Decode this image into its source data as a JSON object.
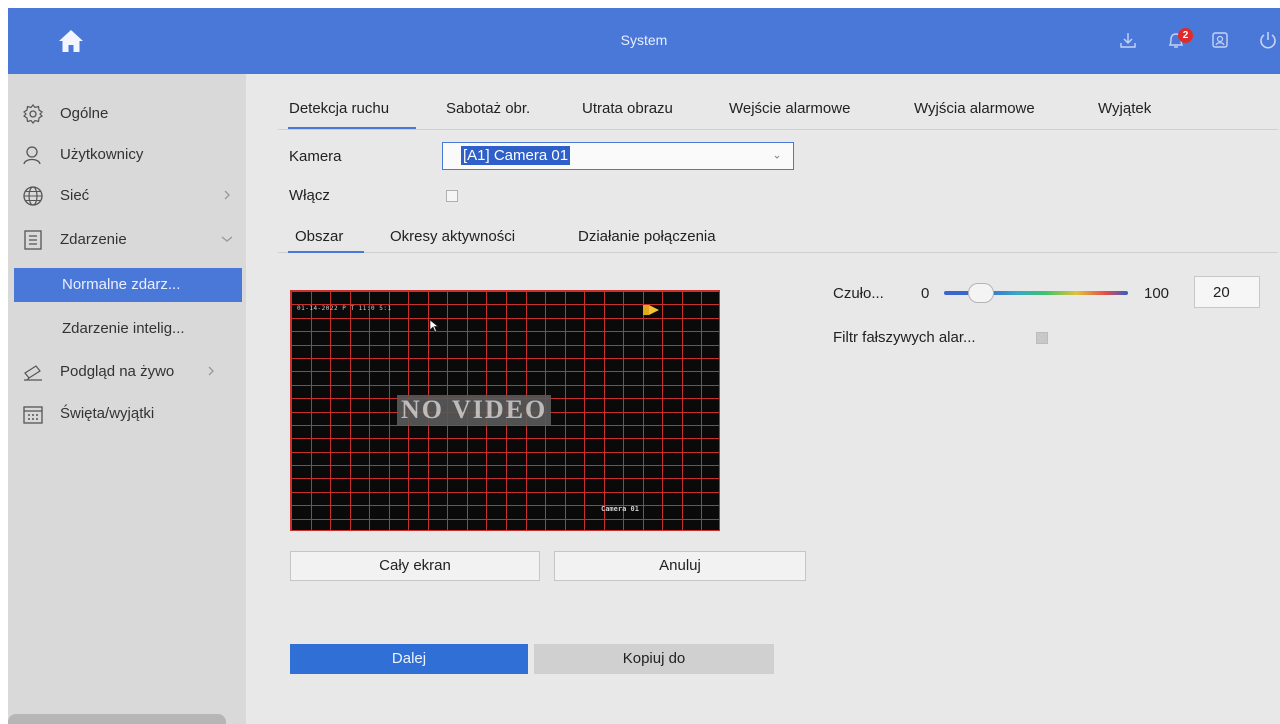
{
  "header": {
    "title": "System",
    "notification_count": "2",
    "icons": [
      "home-icon",
      "download-icon",
      "bell-icon",
      "account-icon",
      "power-icon"
    ]
  },
  "sidebar": {
    "items": [
      {
        "label": "Ogólne",
        "icon": "gear-icon"
      },
      {
        "label": "Użytkownicy",
        "icon": "user-icon"
      },
      {
        "label": "Sieć",
        "icon": "globe-icon"
      },
      {
        "label": "Zdarzenie",
        "icon": "clipboard-icon"
      },
      {
        "label": "Podgląd na żywo",
        "icon": "camera-icon"
      },
      {
        "label": "Święta/wyjątki",
        "icon": "calendar-icon"
      }
    ],
    "subitems": [
      {
        "label": "Normalne zdarz...",
        "active": true
      },
      {
        "label": "Zdarzenie intelig...",
        "active": false
      }
    ]
  },
  "tabs": [
    "Detekcja ruchu",
    "Sabotaż obr.",
    "Utrata obrazu",
    "Wejście alarmowe",
    "Wyjścia alarmowe",
    "Wyjątek"
  ],
  "form": {
    "camera_label": "Kamera",
    "camera_value": "[A1] Camera 01",
    "enable_label": "Włącz"
  },
  "subtabs": [
    "Obszar",
    "Okresy aktywności",
    "Działanie połączenia"
  ],
  "video": {
    "osd_time": "01-14-2022 P T 11:0 5:1",
    "no_video": "NO VIDEO",
    "camera_name": "Camera 01"
  },
  "sensitivity": {
    "label": "Czuło...",
    "min": "0",
    "max": "100",
    "value": "20",
    "level_fraction": 0.2
  },
  "false_alarm": {
    "label": "Filtr fałszywych alar..."
  },
  "buttons": {
    "fullscreen": "Cały ekran",
    "cancel": "Anuluj",
    "next": "Dalej",
    "copy_to": "Kopiuj do"
  },
  "colors": {
    "accent": "#4a78d8",
    "grid": "#c8302e",
    "badge": "#e02b2b"
  }
}
